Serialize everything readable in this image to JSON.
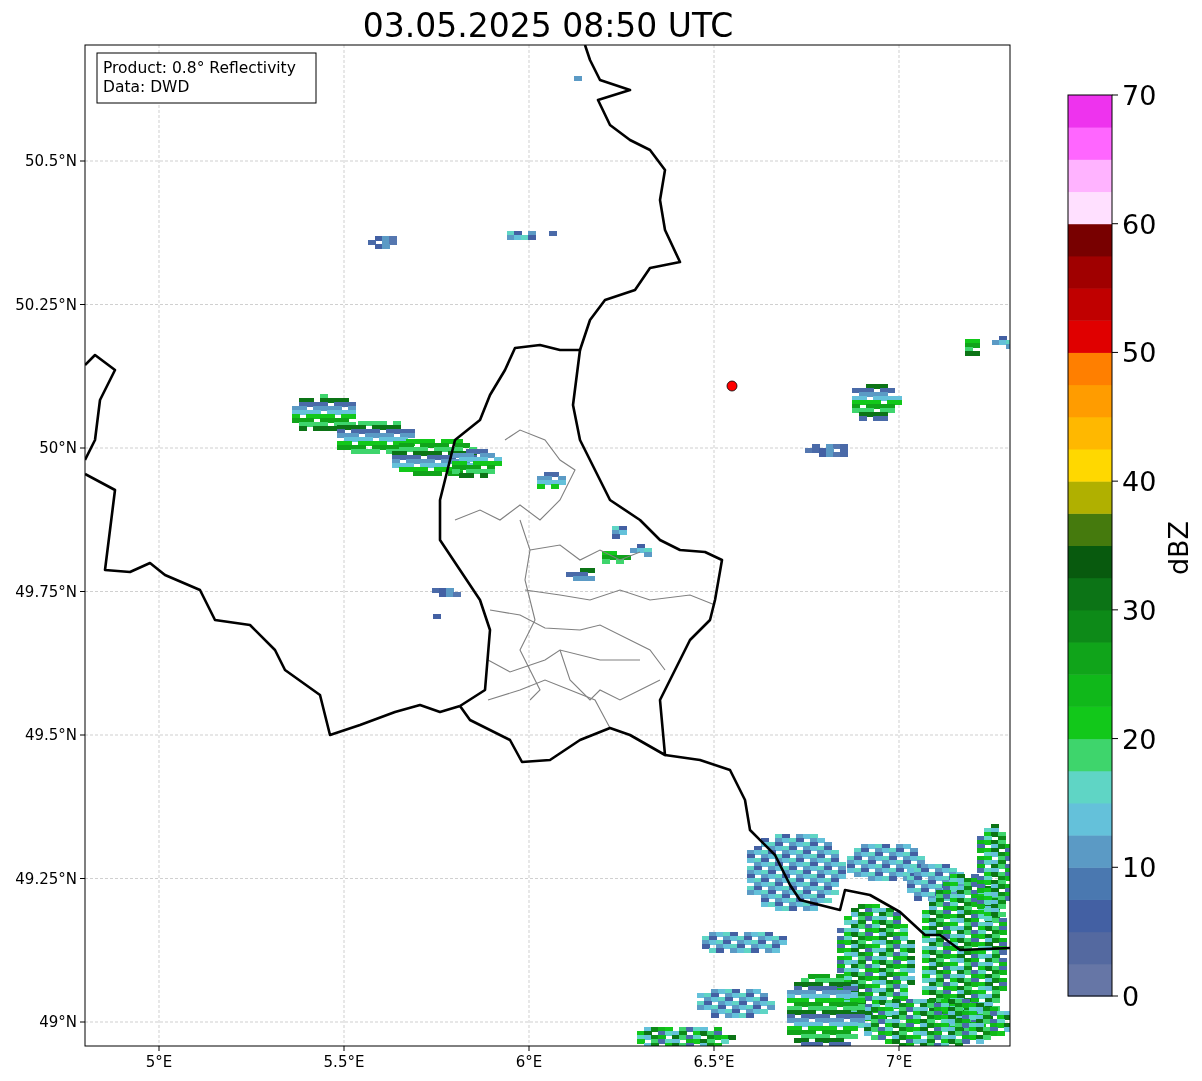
{
  "title": "03.05.2025 08:50 UTC",
  "info_box": {
    "lines": [
      "Product: 0.8° Reflectivity",
      "Data: DWD"
    ]
  },
  "y_axis": {
    "ticks": [
      "50.5°N",
      "50.25°N",
      "50°N",
      "49.75°N",
      "49.5°N",
      "49.25°N",
      "49°N"
    ]
  },
  "x_axis": {
    "ticks": [
      "5°E",
      "5.5°E",
      "6°E",
      "6.5°E",
      "7°E"
    ]
  },
  "colorbar": {
    "label": "dBZ",
    "ticks": [
      "70",
      "60",
      "50",
      "40",
      "30",
      "20",
      "10",
      "0"
    ],
    "bands": [
      {
        "color": "#6676a6"
      },
      {
        "color": "#5469a0"
      },
      {
        "color": "#4360a3"
      },
      {
        "color": "#4a78b0"
      },
      {
        "color": "#5b9ac5"
      },
      {
        "color": "#64c1da"
      },
      {
        "color": "#5fd5c5"
      },
      {
        "color": "#3ed56c"
      },
      {
        "color": "#12c81a"
      },
      {
        "color": "#10b81a"
      },
      {
        "color": "#10a41a"
      },
      {
        "color": "#0d8a18"
      },
      {
        "color": "#0c7416"
      },
      {
        "color": "#085a0e"
      },
      {
        "color": "#457a0d"
      },
      {
        "color": "#b0b000"
      },
      {
        "color": "#ffd800"
      },
      {
        "color": "#ffb800"
      },
      {
        "color": "#ff9c00"
      },
      {
        "color": "#ff7f00"
      },
      {
        "color": "#e00000"
      },
      {
        "color": "#c00000"
      },
      {
        "color": "#a00000"
      },
      {
        "color": "#780000"
      },
      {
        "color": "#ffe0ff"
      },
      {
        "color": "#ffb3ff"
      },
      {
        "color": "#ff66ff"
      },
      {
        "color": "#ee33ee"
      }
    ]
  }
}
